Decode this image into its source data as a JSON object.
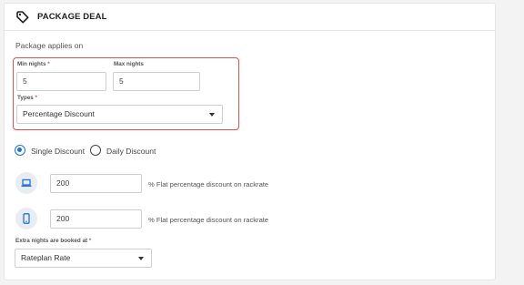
{
  "header": {
    "title": "PACKAGE DEAL",
    "icon": "tag-icon"
  },
  "applies_label": "Package applies on",
  "min_nights": {
    "label": "Min nights",
    "required": "*",
    "value": "5"
  },
  "max_nights": {
    "label": "Max nights",
    "value": "5"
  },
  "types": {
    "label": "Types",
    "required": "*",
    "selected": "Percentage Discount"
  },
  "discount_mode": {
    "options": [
      {
        "label": "Single Discount",
        "checked": true
      },
      {
        "label": "Daily Discount",
        "checked": false
      }
    ]
  },
  "desktop_discount": {
    "icon": "laptop-icon",
    "value": "200",
    "suffix": "% Flat percentage discount on rackrate"
  },
  "mobile_discount": {
    "icon": "mobile-phone-icon",
    "value": "200",
    "suffix": "% Flat percentage discount on rackrate"
  },
  "extra_nights": {
    "label": "Extra nights are booked at",
    "required": "*",
    "selected": "Rateplan Rate"
  },
  "colors": {
    "accent": "#1a73e8",
    "highlight": "#e04f54",
    "icon_bg": "#e9ecf1",
    "icon_fg": "#1a73e8"
  }
}
